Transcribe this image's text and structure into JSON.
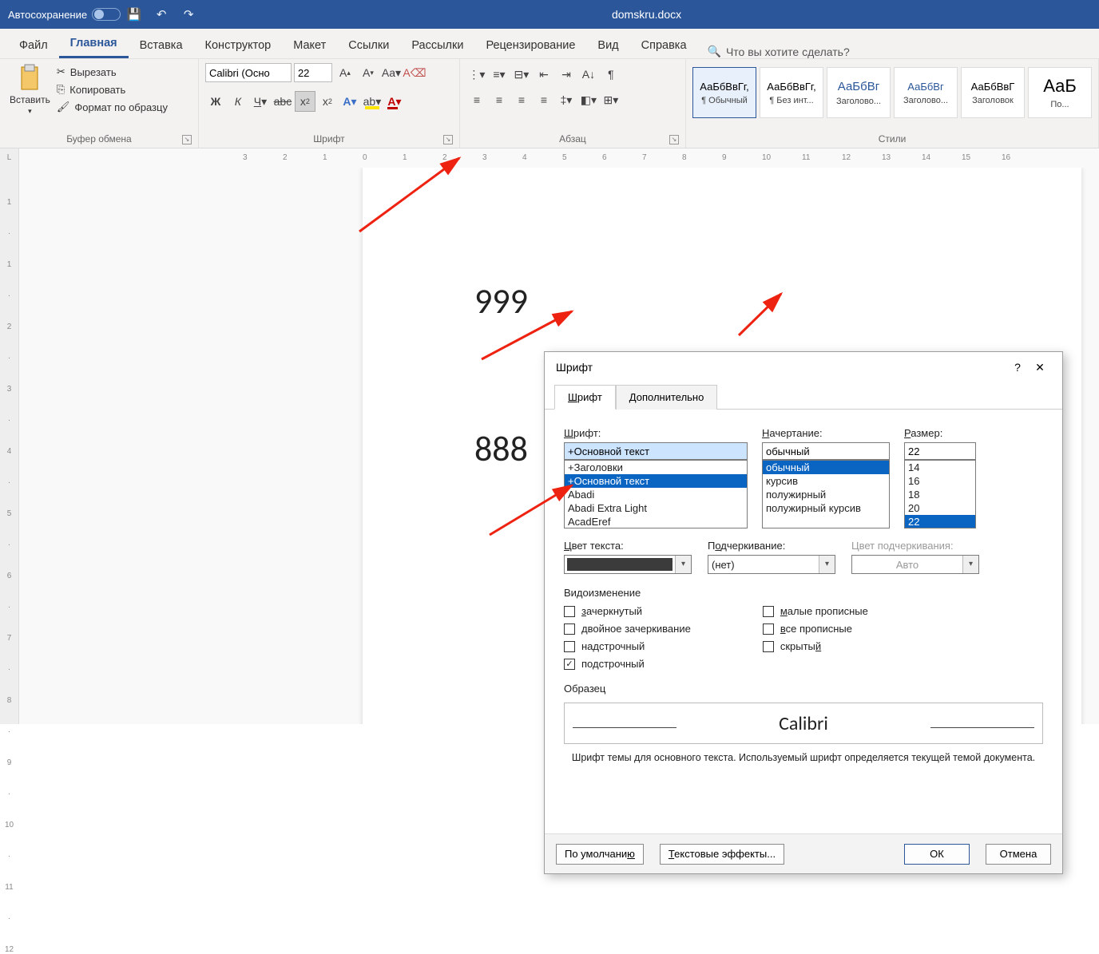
{
  "titlebar": {
    "autosave": "Автосохранение",
    "filename": "domskru.docx"
  },
  "tabs": {
    "file": "Файл",
    "home": "Главная",
    "insert": "Вставка",
    "design": "Конструктор",
    "layout": "Макет",
    "refs": "Ссылки",
    "mail": "Рассылки",
    "review": "Рецензирование",
    "view": "Вид",
    "help": "Справка",
    "tellme": "Что вы хотите сделать?"
  },
  "clip": {
    "paste": "Вставить",
    "cut": "Вырезать",
    "copy": "Копировать",
    "painter": "Формат по образцу",
    "group": "Буфер обмена"
  },
  "font": {
    "name": "Calibri (Осно",
    "size": "22",
    "group": "Шрифт"
  },
  "para": {
    "group": "Абзац"
  },
  "styles": {
    "group": "Стили",
    "items": [
      {
        "prev": "АаБбВвГг,",
        "label": "¶ Обычный"
      },
      {
        "prev": "АаБбВвГг,",
        "label": "¶ Без инт..."
      },
      {
        "prev": "АаБбВг",
        "label": "Заголово..."
      },
      {
        "prev": "АаБбВг",
        "label": "Заголово..."
      },
      {
        "prev": "АаБбВвГ",
        "label": "Заголовок"
      },
      {
        "prev": "АаБ",
        "label": "По..."
      }
    ]
  },
  "doc": {
    "line1": "999",
    "line2": "888"
  },
  "dialog": {
    "title": "Шрифт",
    "help": "?",
    "tab1": "Шрифт",
    "tab2": "Дополнительно",
    "lbl_font": "Шрифт:",
    "lbl_style": "Начертание:",
    "lbl_size": "Размер:",
    "font_value": "+Основной текст",
    "fonts": [
      "+Заголовки",
      "+Основной текст",
      "Abadi",
      "Abadi Extra Light",
      "AcadEref"
    ],
    "style_value": "обычный",
    "styles": [
      "обычный",
      "курсив",
      "полужирный",
      "полужирный курсив"
    ],
    "size_value": "22",
    "sizes": [
      "14",
      "16",
      "18",
      "20",
      "22"
    ],
    "lbl_color": "Цвет текста:",
    "lbl_under": "Подчеркивание:",
    "lbl_undercolor": "Цвет подчеркивания:",
    "under_val": "(нет)",
    "undercolor_val": "Авто",
    "lbl_effects": "Видоизменение",
    "chk1": "зачеркнутый",
    "chk2": "двойное зачеркивание",
    "chk3": "надстрочный",
    "chk4": "подстрочный",
    "chk5": "малые прописные",
    "chk6": "все прописные",
    "chk7": "скрытый",
    "lbl_preview": "Образец",
    "preview_font": "Calibri",
    "note": "Шрифт темы для основного текста. Используемый шрифт определяется текущей темой документа.",
    "btn_default": "По умолчанию",
    "btn_effects": "Текстовые эффекты...",
    "btn_ok": "ОК",
    "btn_cancel": "Отмена"
  },
  "ruler_v": [
    " ",
    "1",
    "·",
    "1",
    "·",
    "2",
    "·",
    "3",
    "·",
    "4",
    "·",
    "5",
    "·",
    "6",
    "·",
    "7",
    "·",
    "8",
    "·",
    "9",
    "·",
    "10",
    "·",
    "11",
    "·",
    "12"
  ]
}
